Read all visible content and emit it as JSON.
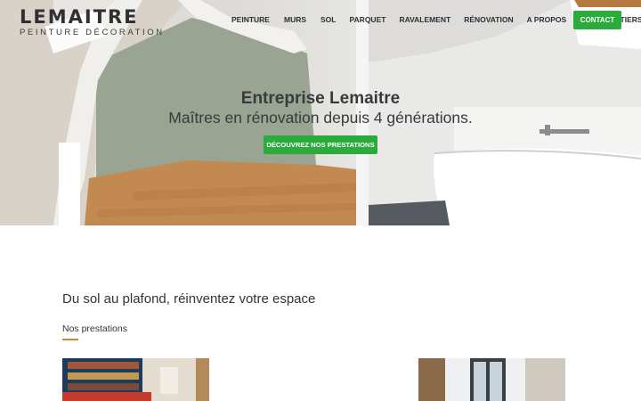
{
  "header": {
    "logo_main": "LEMAITRE",
    "logo_sub": "PEINTURE DÉCORATION",
    "nav": [
      {
        "label": "PEINTURE"
      },
      {
        "label": "MURS"
      },
      {
        "label": "SOL"
      },
      {
        "label": "PARQUET"
      },
      {
        "label": "RAVALEMENT"
      },
      {
        "label": "RÉNOVATION"
      },
      {
        "label": "A PROPOS"
      },
      {
        "label": "NOS CHANTIERS"
      }
    ],
    "contact_label": "CONTACT"
  },
  "hero": {
    "title": "Entreprise Lemaitre",
    "subtitle": "Maîtres en rénovation depuis 4 générations.",
    "cta_label": "DÉCOUVREZ NOS PRESTATIONS"
  },
  "main": {
    "section_title": "Du sol au plafond, réinventez votre espace",
    "section_label": "Nos prestations"
  },
  "colors": {
    "accent_green": "#2bab3c",
    "accent_orange": "#d7822e",
    "text_dark": "#333333"
  }
}
